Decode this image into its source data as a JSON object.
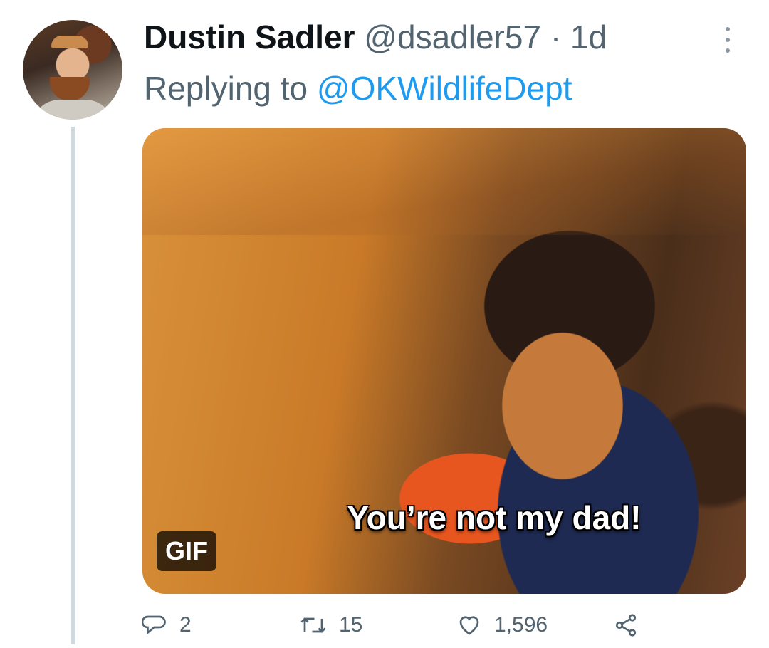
{
  "tweet": {
    "author_name": "Dustin Sadler",
    "author_handle": "@dsadler57",
    "separator": "·",
    "time": "1d",
    "replying_prefix": "Replying to",
    "replying_handle": "@OKWildlifeDept"
  },
  "media": {
    "caption": "You’re not my dad!",
    "badge": "GIF"
  },
  "actions": {
    "replies": "2",
    "retweets": "15",
    "likes": "1,596"
  },
  "colors": {
    "link": "#1d9bf0",
    "secondary_text": "#536471",
    "thread_line": "#cfd9de"
  },
  "icons": [
    "more-icon",
    "reply-icon",
    "retweet-icon",
    "like-icon",
    "share-icon"
  ]
}
